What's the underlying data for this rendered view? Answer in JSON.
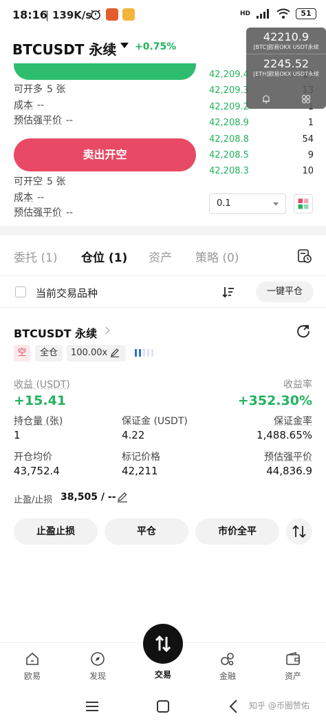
{
  "status_bar": {
    "time": "18:16",
    "speed": "139K/s",
    "network": "HD",
    "battery": "51"
  },
  "header": {
    "pair": "BTCUSDT 永续",
    "change": "+0.75%"
  },
  "floating_ticker": [
    {
      "price": "42210.9",
      "label": "[BTC]欧易OKX USDT永续"
    },
    {
      "price": "2245.52",
      "label": "[ETH]欧易OKX USDT永续"
    }
  ],
  "order_form": {
    "long": {
      "open_label": "可开多",
      "open_value": "5 张",
      "cost_label": "成本",
      "cost_value": "--",
      "liq_label": "预估强平价",
      "liq_value": "--"
    },
    "sell_button": "卖出开空",
    "short": {
      "open_label": "可开空",
      "open_value": "5 张",
      "cost_label": "成本",
      "cost_value": "--",
      "liq_label": "预估强平价",
      "liq_value": "--"
    }
  },
  "order_book": [
    {
      "price": "42,209.4",
      "qty": "10"
    },
    {
      "price": "42,209.3",
      "qty": "13"
    },
    {
      "price": "42,209.2",
      "qty": "1"
    },
    {
      "price": "42,208.9",
      "qty": "1"
    },
    {
      "price": "42,208.8",
      "qty": "54"
    },
    {
      "price": "42,208.5",
      "qty": "9"
    },
    {
      "price": "42,208.3",
      "qty": "10"
    }
  ],
  "step_select": {
    "value": "0.1"
  },
  "tabs": [
    {
      "label": "委托 (1)"
    },
    {
      "label": "仓位 (1)"
    },
    {
      "label": "资产"
    },
    {
      "label": "策略 (0)"
    }
  ],
  "filter": {
    "label": "当前交易品种",
    "close_all": "一键平仓"
  },
  "position": {
    "title": "BTCUSDT 永续",
    "side_tag": "空",
    "margin_tag": "全仓",
    "leverage_tag": "100.00x",
    "pnl_label": "收益 (USDT)",
    "pnl_value": "+15.41",
    "roe_label": "收益率",
    "roe_value": "+352.30%",
    "size_label": "持仓量 (张)",
    "size_value": "1",
    "margin_label": "保证金 (USDT)",
    "margin_value": "4.22",
    "margin_ratio_label": "保证金率",
    "margin_ratio_value": "1,488.65%",
    "entry_label": "开仓均价",
    "entry_value": "43,752.4",
    "mark_label": "标记价格",
    "mark_value": "42,211",
    "liq_label": "预估强平价",
    "liq_value": "44,836.9",
    "tpsl_label": "止盈/止损",
    "tpsl_value": "38,505 / --",
    "buttons": {
      "tpsl": "止盈止损",
      "close": "平仓",
      "market_close": "市价全平"
    }
  },
  "bottom_nav": [
    {
      "label": "欧易"
    },
    {
      "label": "发现"
    },
    {
      "label": "交易"
    },
    {
      "label": "金融"
    },
    {
      "label": "资产"
    }
  ],
  "watermark": "知乎 @币圈赞佑",
  "colors": {
    "green": "#22b35e",
    "red": "#e84a66",
    "buy_green": "#2ebd6f"
  }
}
